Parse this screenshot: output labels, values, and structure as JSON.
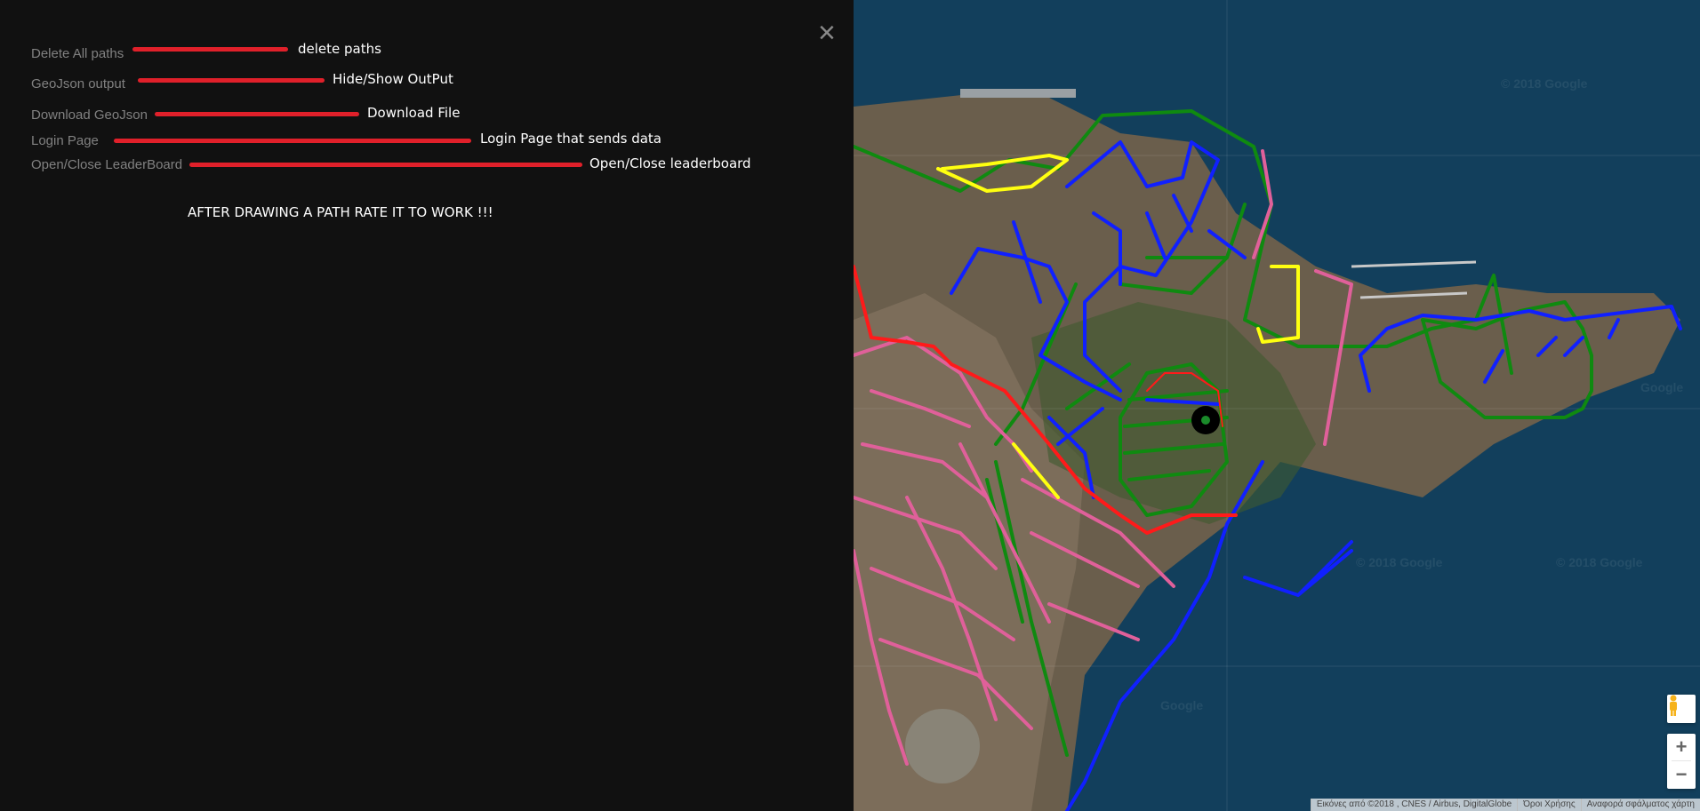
{
  "sidenav": {
    "close_icon": "×",
    "items": [
      {
        "label": "Delete All paths",
        "annotation": "delete paths"
      },
      {
        "label": "GeoJson output",
        "annotation": "Hide/Show OutPut"
      },
      {
        "label": "Download GeoJson",
        "annotation": "Download File"
      },
      {
        "label": "Login Page",
        "annotation": "Login Page that sends data"
      },
      {
        "label": "Open/Close LeaderBoard",
        "annotation": "Open/Close leaderboard"
      }
    ],
    "notice": "AFTER DRAWING A PATH RATE IT TO WORK !!!"
  },
  "map": {
    "watermark": "© 2018 Google",
    "watermark_short": "Google",
    "zoom_in": "+",
    "zoom_out": "−",
    "attribution": [
      "Εικόνες από ©2018 , CNES / Airbus, DigitalGlobe",
      "Όροι Χρήσης",
      "Αναφορά σφάλματος χάρτη"
    ],
    "path_colors": {
      "green": "#0f8a10",
      "blue": "#1020ff",
      "pink": "#e0609a",
      "red": "#ff1a1a",
      "yellow": "#ffff10"
    }
  }
}
